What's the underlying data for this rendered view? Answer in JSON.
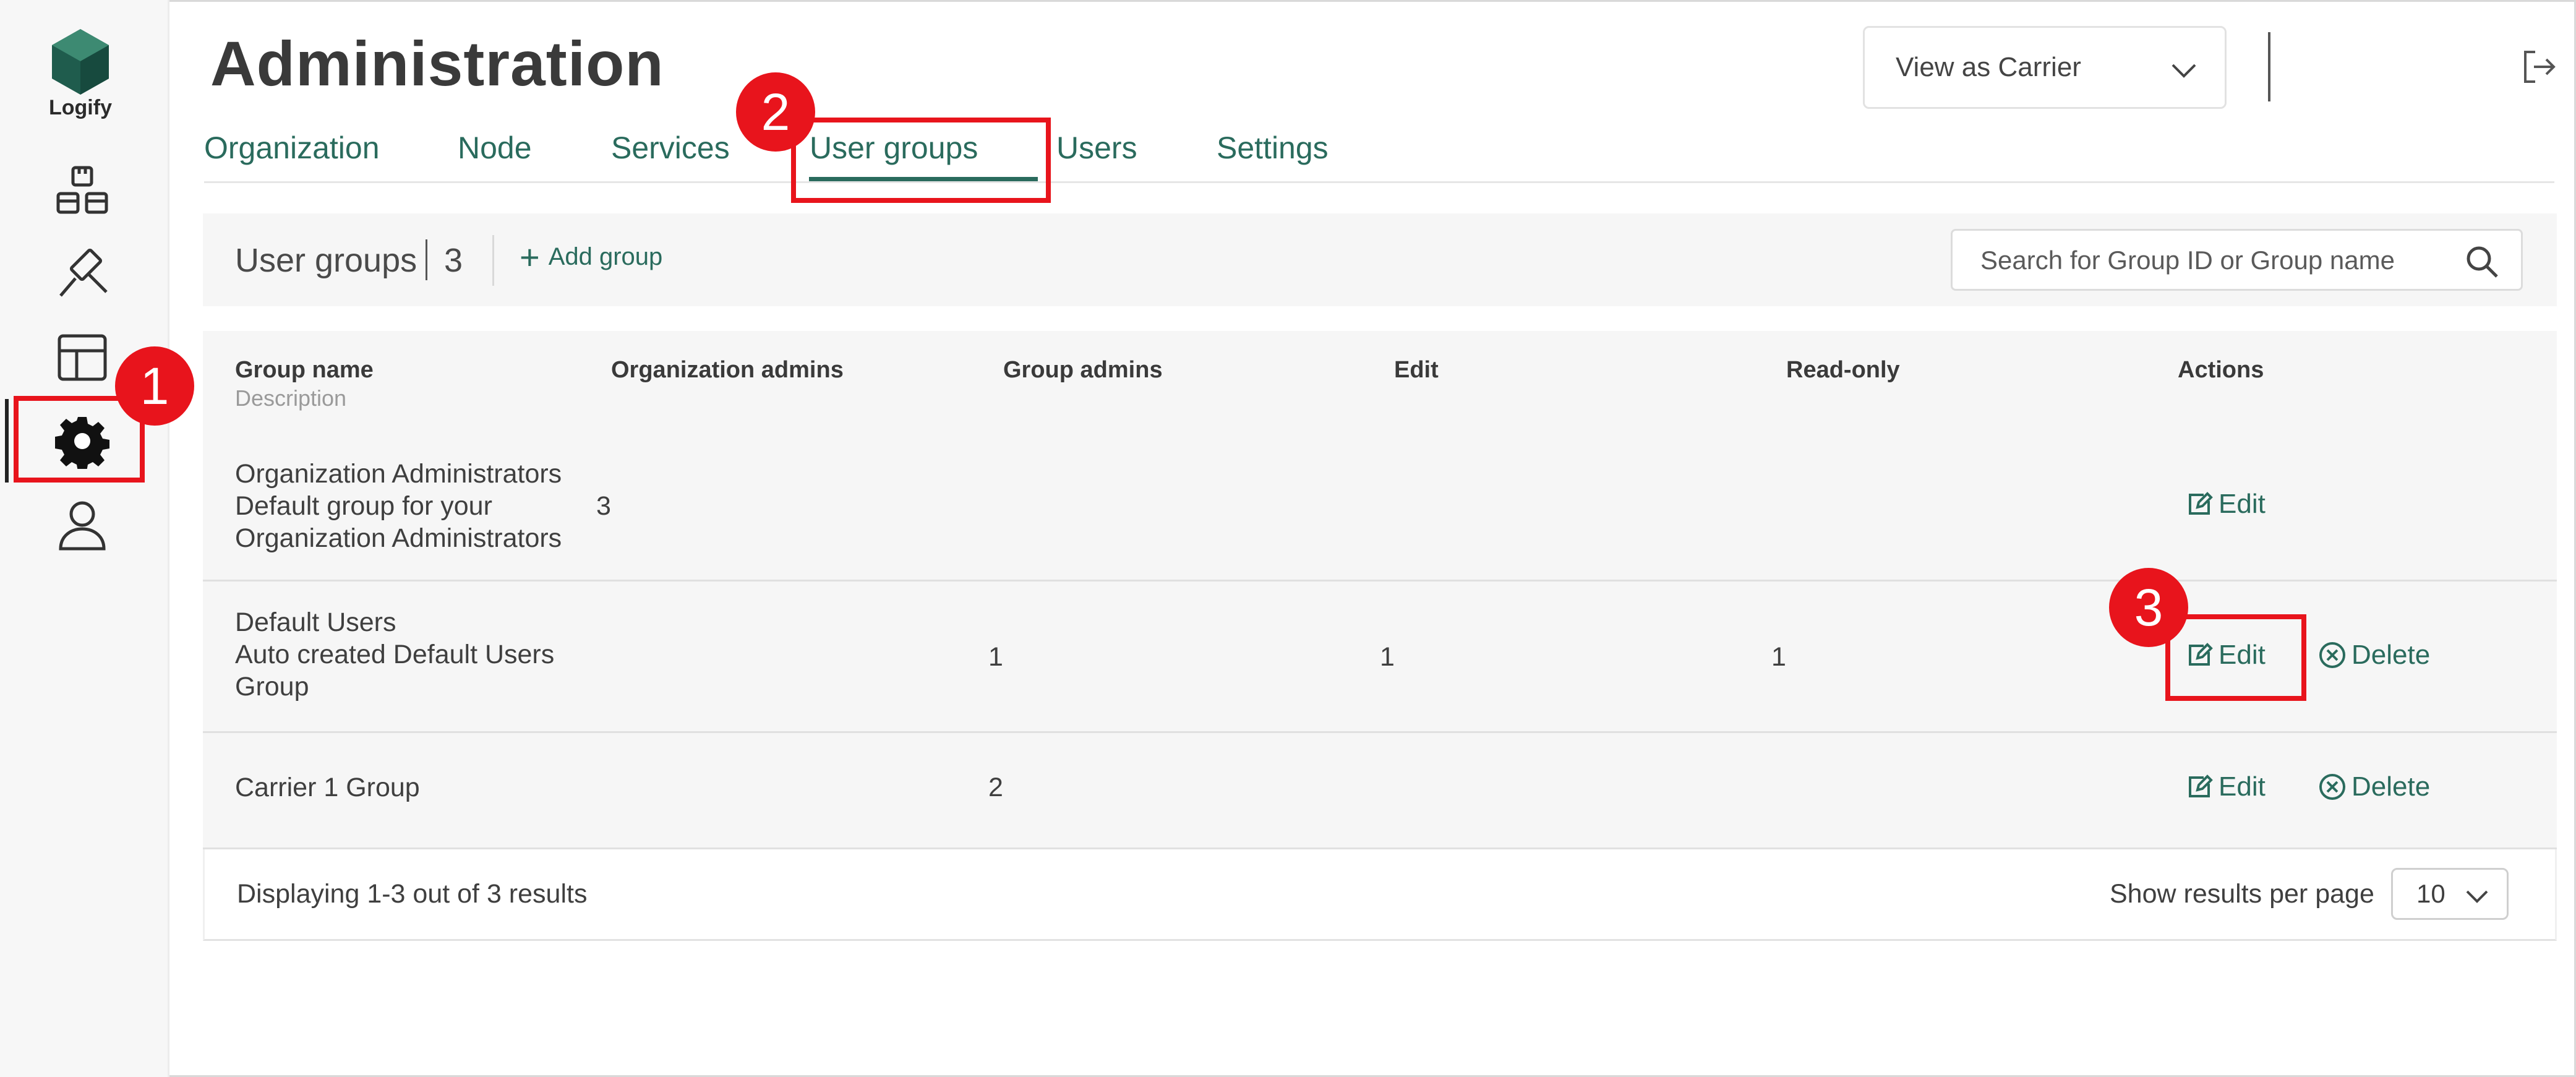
{
  "app": {
    "logo_text": "Logify"
  },
  "colors": {
    "accent": "#2a6b5d",
    "annotation": "#e8141c",
    "logo": "#1f5c4d"
  },
  "sidebar": {
    "items": [
      {
        "icon": "packages-icon"
      },
      {
        "icon": "hammer-icon"
      },
      {
        "icon": "layout-icon"
      },
      {
        "icon": "gear-icon",
        "active": true
      },
      {
        "icon": "user-icon"
      }
    ]
  },
  "header": {
    "title": "Administration",
    "view_select": "View as Carrier"
  },
  "tabs": [
    {
      "label": "Organization"
    },
    {
      "label": "Node"
    },
    {
      "label": "Services"
    },
    {
      "label": "User groups",
      "active": true
    },
    {
      "label": "Users"
    },
    {
      "label": "Settings"
    }
  ],
  "toolbar": {
    "title": "User groups",
    "count": "3",
    "add_label": "Add group",
    "search_placeholder": "Search for Group ID or Group name"
  },
  "table": {
    "columns": {
      "group_name": "Group name",
      "description": "Description",
      "org_admins": "Organization admins",
      "group_admins": "Group admins",
      "edit": "Edit",
      "read_only": "Read-only",
      "actions": "Actions"
    },
    "rows": [
      {
        "name": "Organization Administrators",
        "desc_line1": "Default group for your",
        "desc_line2": "Organization Administrators",
        "org_admins": "3",
        "group_admins": "",
        "edit": "",
        "read_only": "",
        "edit_label": "Edit"
      },
      {
        "name": "Default Users",
        "desc_line1": "Auto created Default Users",
        "desc_line2": "Group",
        "org_admins": "",
        "group_admins": "1",
        "edit": "1",
        "read_only": "1",
        "edit_label": "Edit",
        "delete_label": "Delete"
      },
      {
        "name": "Carrier 1 Group",
        "org_admins": "",
        "group_admins": "2",
        "edit": "",
        "read_only": "",
        "edit_label": "Edit",
        "delete_label": "Delete"
      }
    ]
  },
  "footer": {
    "display_text": "Displaying 1-3 out of 3 results",
    "per_page_label": "Show results per page",
    "per_page_value": "10"
  },
  "annotations": [
    {
      "number": "1"
    },
    {
      "number": "2"
    },
    {
      "number": "3"
    }
  ]
}
